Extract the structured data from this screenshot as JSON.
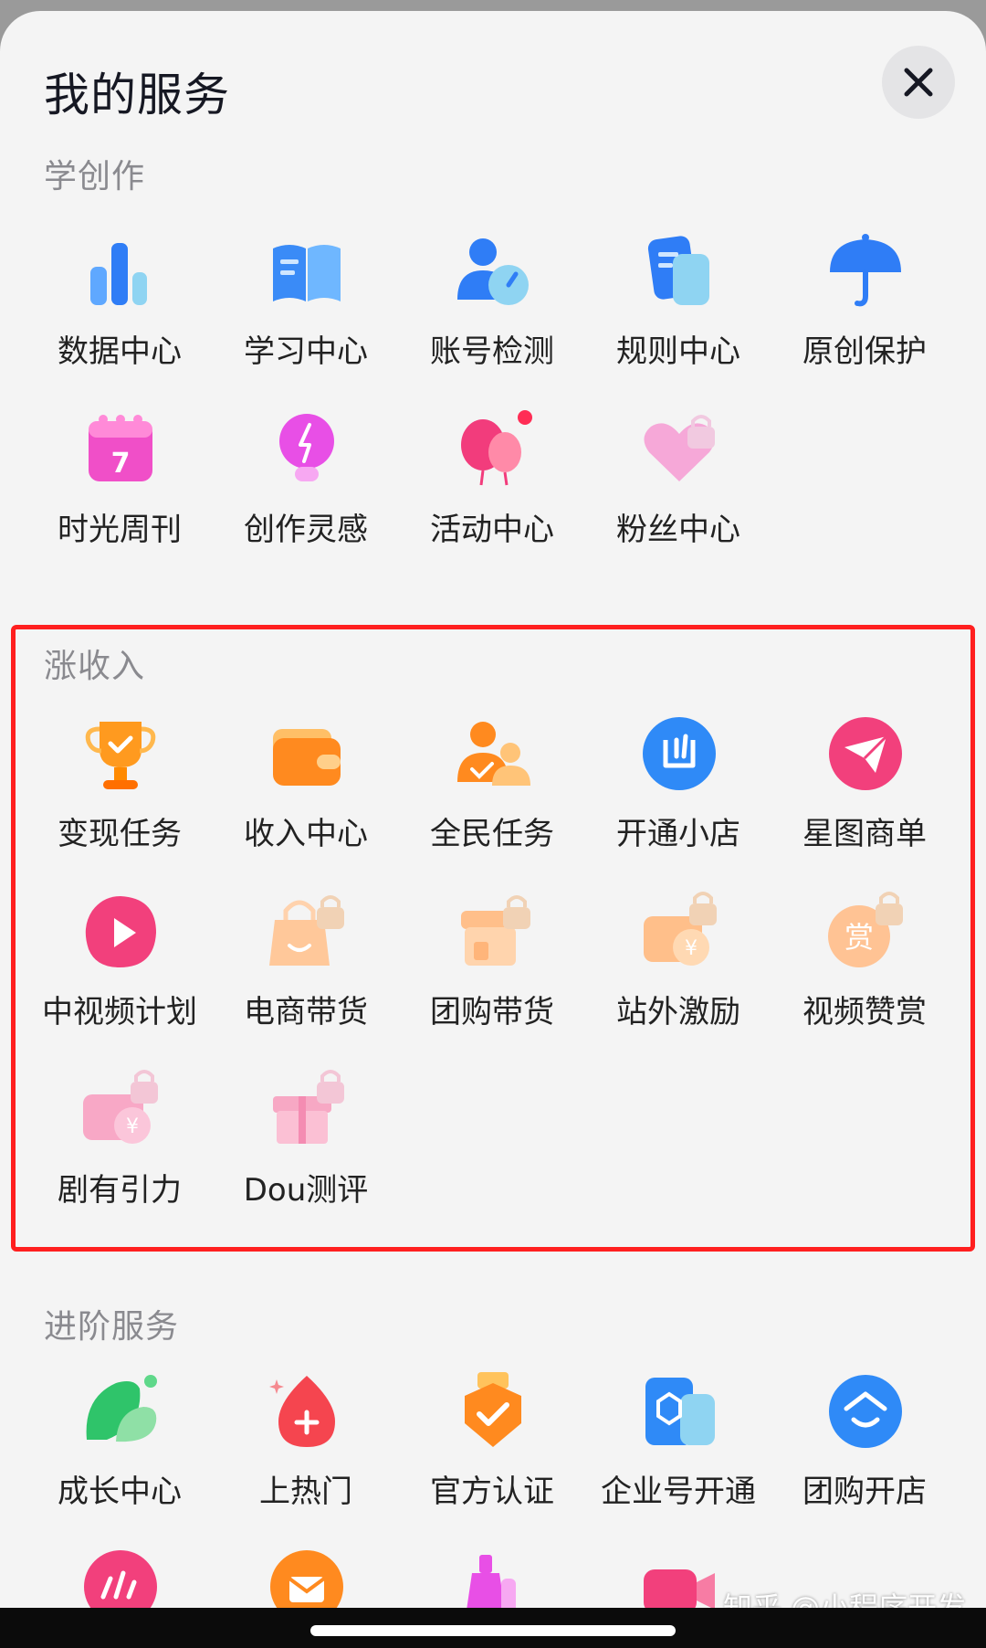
{
  "header": {
    "title": "我的服务",
    "close_icon": "close-icon"
  },
  "sections": {
    "create": {
      "title": "学创作",
      "items": [
        {
          "label": "数据中心",
          "icon": "bar-chart-icon"
        },
        {
          "label": "学习中心",
          "icon": "open-book-icon"
        },
        {
          "label": "账号检测",
          "icon": "user-gauge-icon"
        },
        {
          "label": "规则中心",
          "icon": "document-icon"
        },
        {
          "label": "原创保护",
          "icon": "umbrella-icon"
        },
        {
          "label": "时光周刊",
          "icon": "calendar-icon"
        },
        {
          "label": "创作灵感",
          "icon": "lightbulb-icon"
        },
        {
          "label": "活动中心",
          "icon": "balloons-icon"
        },
        {
          "label": "粉丝中心",
          "icon": "heart-lock-icon"
        }
      ]
    },
    "income": {
      "title": "涨收入",
      "items": [
        {
          "label": "变现任务",
          "icon": "trophy-icon"
        },
        {
          "label": "收入中心",
          "icon": "wallet-icon"
        },
        {
          "label": "全民任务",
          "icon": "users-check-icon"
        },
        {
          "label": "开通小店",
          "icon": "shop-icon"
        },
        {
          "label": "星图商单",
          "icon": "paper-plane-icon"
        },
        {
          "label": "中视频计划",
          "icon": "play-icon"
        },
        {
          "label": "电商带货",
          "icon": "shopping-bag-lock-icon"
        },
        {
          "label": "团购带货",
          "icon": "store-lock-icon"
        },
        {
          "label": "站外激励",
          "icon": "video-yuan-lock-icon"
        },
        {
          "label": "视频赞赏",
          "icon": "reward-lock-icon"
        },
        {
          "label": "剧有引力",
          "icon": "film-yuan-lock-icon"
        },
        {
          "label": "Dou测评",
          "icon": "gift-lock-icon"
        }
      ]
    },
    "advanced": {
      "title": "进阶服务",
      "items": [
        {
          "label": "成长中心",
          "icon": "leaf-icon"
        },
        {
          "label": "上热门",
          "icon": "flame-plus-icon"
        },
        {
          "label": "官方认证",
          "icon": "badge-check-icon"
        },
        {
          "label": "企业号开通",
          "icon": "enterprise-icon"
        },
        {
          "label": "团购开店",
          "icon": "shop-smile-icon"
        }
      ],
      "partial_icons": [
        "speed-icon",
        "mail-icon",
        "bottle-icon",
        "camera-icon"
      ]
    }
  },
  "watermark": "知乎 @小程序开发",
  "colors": {
    "highlight": "#ff1f1f",
    "background": "#f4f4f4",
    "text": "#222222",
    "section": "#8a8a8f"
  }
}
